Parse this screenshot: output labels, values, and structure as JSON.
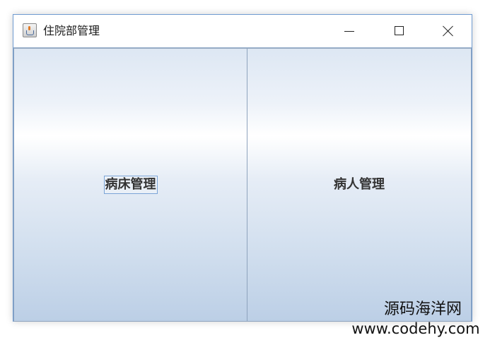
{
  "window": {
    "title": "住院部管理",
    "icon": "java-cup-icon",
    "controls": {
      "minimize": "minimize-icon",
      "maximize": "maximize-icon",
      "close": "close-icon"
    }
  },
  "panels": [
    {
      "label": "病床管理",
      "focused": true
    },
    {
      "label": "病人管理",
      "focused": false
    }
  ],
  "watermark": {
    "line1": "源码海洋网",
    "line2": "www.codehy.com"
  },
  "colors": {
    "window_border": "#6f9bd1",
    "button_gradient_top": "#dde7f3",
    "button_gradient_bottom": "#bccfe6",
    "focus_ring": "#7aa4d6"
  }
}
